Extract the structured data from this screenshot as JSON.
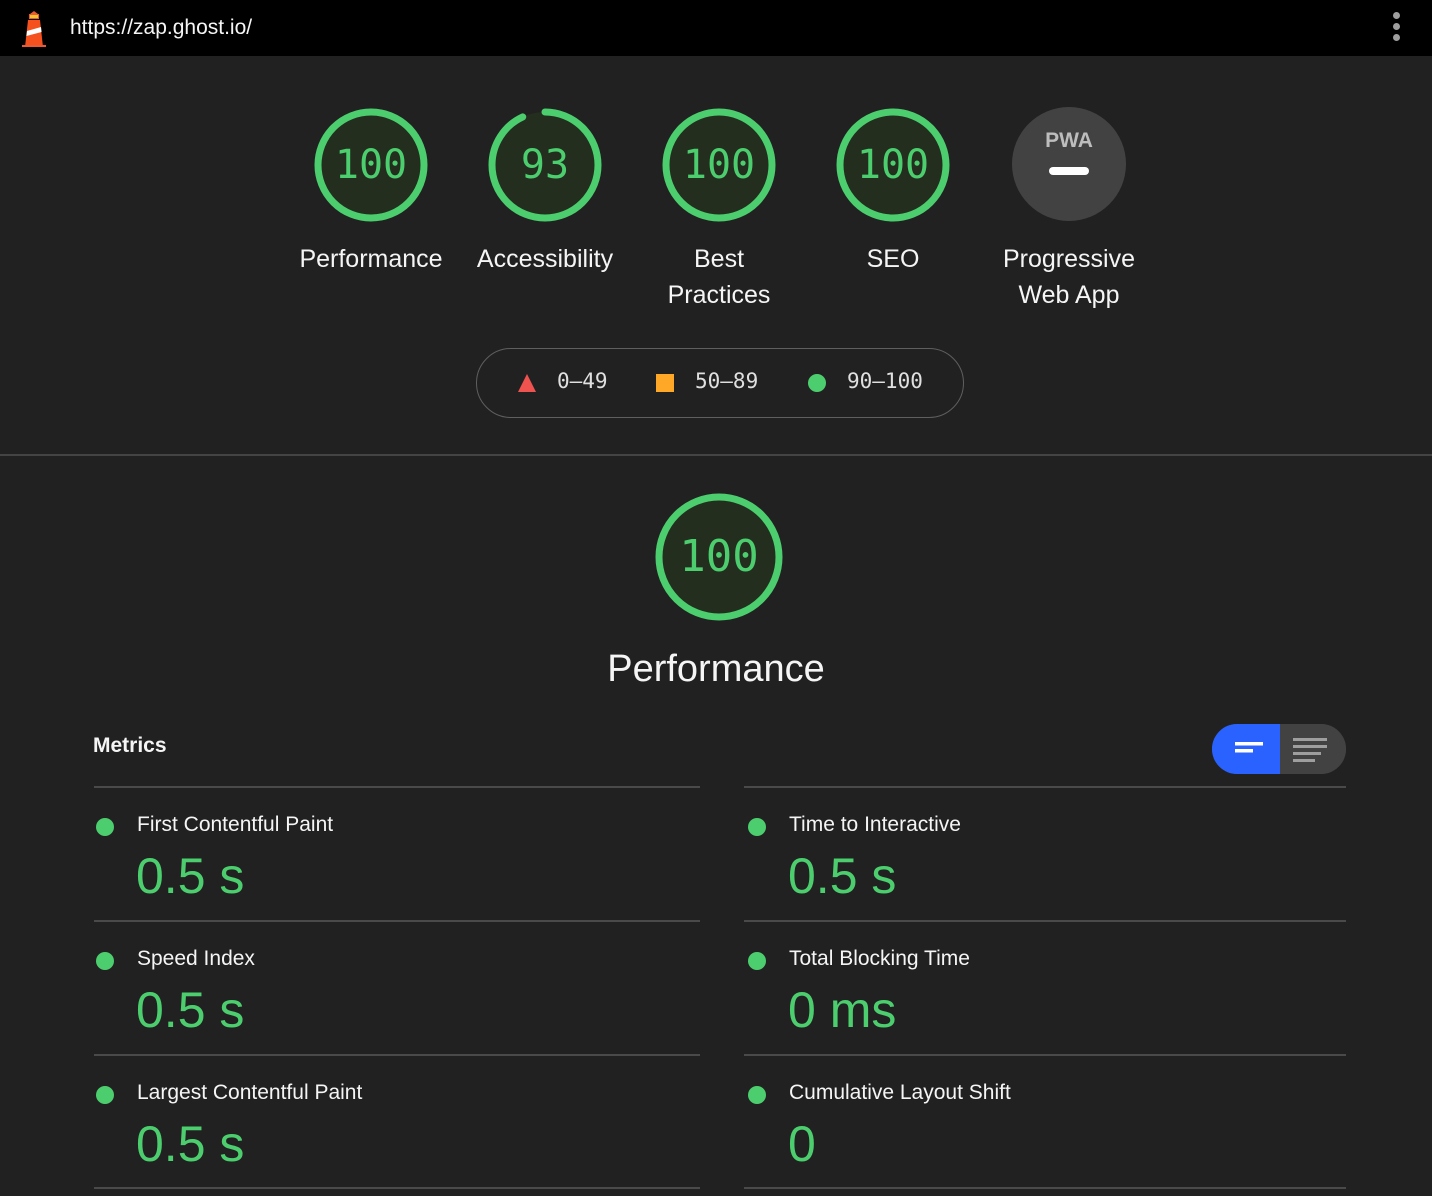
{
  "header": {
    "url": "https://zap.ghost.io/",
    "logo_icon": "lighthouse-icon",
    "menu_icon": "kebab-menu-icon"
  },
  "categories": [
    {
      "label": "Performance",
      "score": "100",
      "fraction": 1.0
    },
    {
      "label": "Accessibility",
      "score": "93",
      "fraction": 0.93
    },
    {
      "label_line1": "Best",
      "label_line2": "Practices",
      "score": "100",
      "fraction": 1.0
    },
    {
      "label": "SEO",
      "score": "100",
      "fraction": 1.0
    },
    {
      "label_line1": "Progressive",
      "label_line2": "Web App",
      "badge": "PWA"
    }
  ],
  "legend": [
    {
      "range": "0–49",
      "shape": "triangle",
      "color": "#ef5350"
    },
    {
      "range": "50–89",
      "shape": "square",
      "color": "#ffa726"
    },
    {
      "range": "90–100",
      "shape": "circle",
      "color": "#4cce6e"
    }
  ],
  "performance": {
    "score": "100",
    "fraction": 1.0,
    "title": "Performance"
  },
  "metrics": {
    "title": "Metrics",
    "items": [
      {
        "label": "First Contentful Paint",
        "value": "0.5 s"
      },
      {
        "label": "Time to Interactive",
        "value": "0.5 s"
      },
      {
        "label": "Speed Index",
        "value": "0.5 s"
      },
      {
        "label": "Total Blocking Time",
        "value": "0 ms"
      },
      {
        "label": "Largest Contentful Paint",
        "value": "0.5 s"
      },
      {
        "label": "Cumulative Layout Shift",
        "value": "0"
      }
    ]
  },
  "colors": {
    "pass": "#4cce6e",
    "average": "#ffa726",
    "fail": "#ef5350",
    "toggle_active": "#2962ff",
    "background": "#212121"
  }
}
